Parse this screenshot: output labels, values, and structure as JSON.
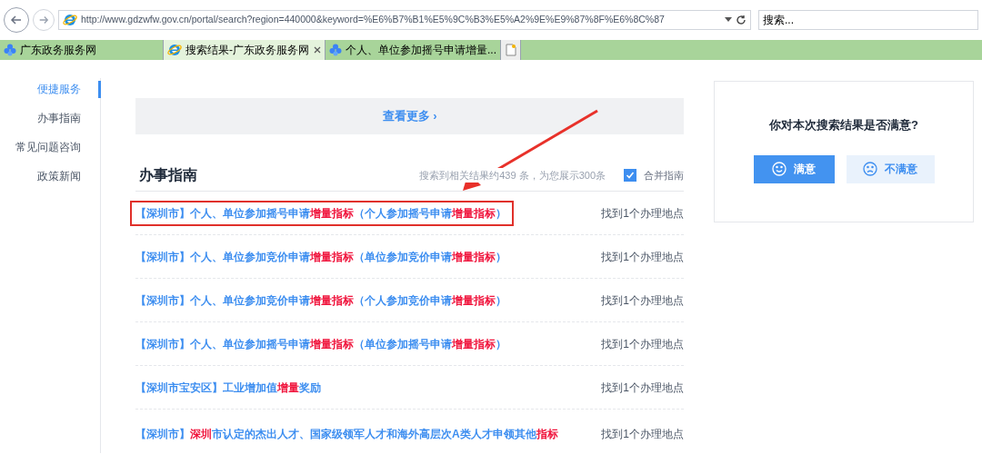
{
  "browser": {
    "url": "http://www.gdzwfw.gov.cn/portal/search?region=440000&keyword=%E6%B7%B1%E5%9C%B3%E5%A2%9E%E9%87%8F%E6%8C%87",
    "search_placeholder": "搜索...",
    "tabs": [
      {
        "title": "广东政务服务网",
        "selected": false,
        "kind": "site"
      },
      {
        "title": "搜索结果-广东政务服务网",
        "selected": true,
        "kind": "ie"
      },
      {
        "title": "个人、单位参加摇号申请增量...",
        "selected": false,
        "kind": "site"
      }
    ]
  },
  "sidebar": {
    "items": [
      {
        "label": "便捷服务",
        "selected": true
      },
      {
        "label": "办事指南",
        "selected": false
      },
      {
        "label": "常见问题咨询",
        "selected": false
      },
      {
        "label": "政策新闻",
        "selected": false
      }
    ]
  },
  "more_link": "查看更多 ›",
  "section": {
    "title": "办事指南",
    "summary": "搜索到相关结果约439 条，为您展示300条",
    "merge": {
      "label": "合并指南",
      "checked": true
    }
  },
  "results": [
    {
      "annotated": true,
      "location": "找到1个办理地点",
      "title": [
        {
          "text": "【深圳市】个人、单位参加摇号申请",
          "highlight": false
        },
        {
          "text": "增量指标",
          "highlight": true
        },
        {
          "text": "（个人参加摇号申请",
          "highlight": false
        },
        {
          "text": "增量指标",
          "highlight": true
        },
        {
          "text": "）",
          "highlight": false
        }
      ]
    },
    {
      "annotated": false,
      "location": "找到1个办理地点",
      "title": [
        {
          "text": "【深圳市】个人、单位参加竞价申请",
          "highlight": false
        },
        {
          "text": "增量指标",
          "highlight": true
        },
        {
          "text": "（单位参加竞价申请",
          "highlight": false
        },
        {
          "text": "增量指标",
          "highlight": true
        },
        {
          "text": "）",
          "highlight": false
        }
      ]
    },
    {
      "annotated": false,
      "location": "找到1个办理地点",
      "title": [
        {
          "text": "【深圳市】个人、单位参加竞价申请",
          "highlight": false
        },
        {
          "text": "增量指标",
          "highlight": true
        },
        {
          "text": "（个人参加竞价申请",
          "highlight": false
        },
        {
          "text": "增量指标",
          "highlight": true
        },
        {
          "text": "）",
          "highlight": false
        }
      ]
    },
    {
      "annotated": false,
      "location": "找到1个办理地点",
      "title": [
        {
          "text": "【深圳市】个人、单位参加摇号申请",
          "highlight": false
        },
        {
          "text": "增量指标",
          "highlight": true
        },
        {
          "text": "（单位参加摇号申请",
          "highlight": false
        },
        {
          "text": "增量指标",
          "highlight": true
        },
        {
          "text": "）",
          "highlight": false
        }
      ]
    },
    {
      "annotated": false,
      "location": "找到1个办理地点",
      "title": [
        {
          "text": "【深圳市宝安区】工业增加值",
          "highlight": false
        },
        {
          "text": "增量",
          "highlight": true
        },
        {
          "text": "奖励",
          "highlight": false
        }
      ]
    },
    {
      "annotated": false,
      "location": "找到1个办理地点",
      "title": [
        {
          "text": "【深圳市】",
          "highlight": false
        },
        {
          "text": "深圳",
          "highlight": true
        },
        {
          "text": "市认定的杰出人才、国家级领军人才和海外高层次A类人才申领其他",
          "highlight": false
        },
        {
          "text": "指标",
          "highlight": true
        }
      ]
    }
  ],
  "feedback": {
    "question": "你对本次搜索结果是否满意?",
    "buttons": [
      {
        "label": "满意",
        "kind": "good"
      },
      {
        "label": "不满意",
        "kind": "bad"
      }
    ]
  }
}
